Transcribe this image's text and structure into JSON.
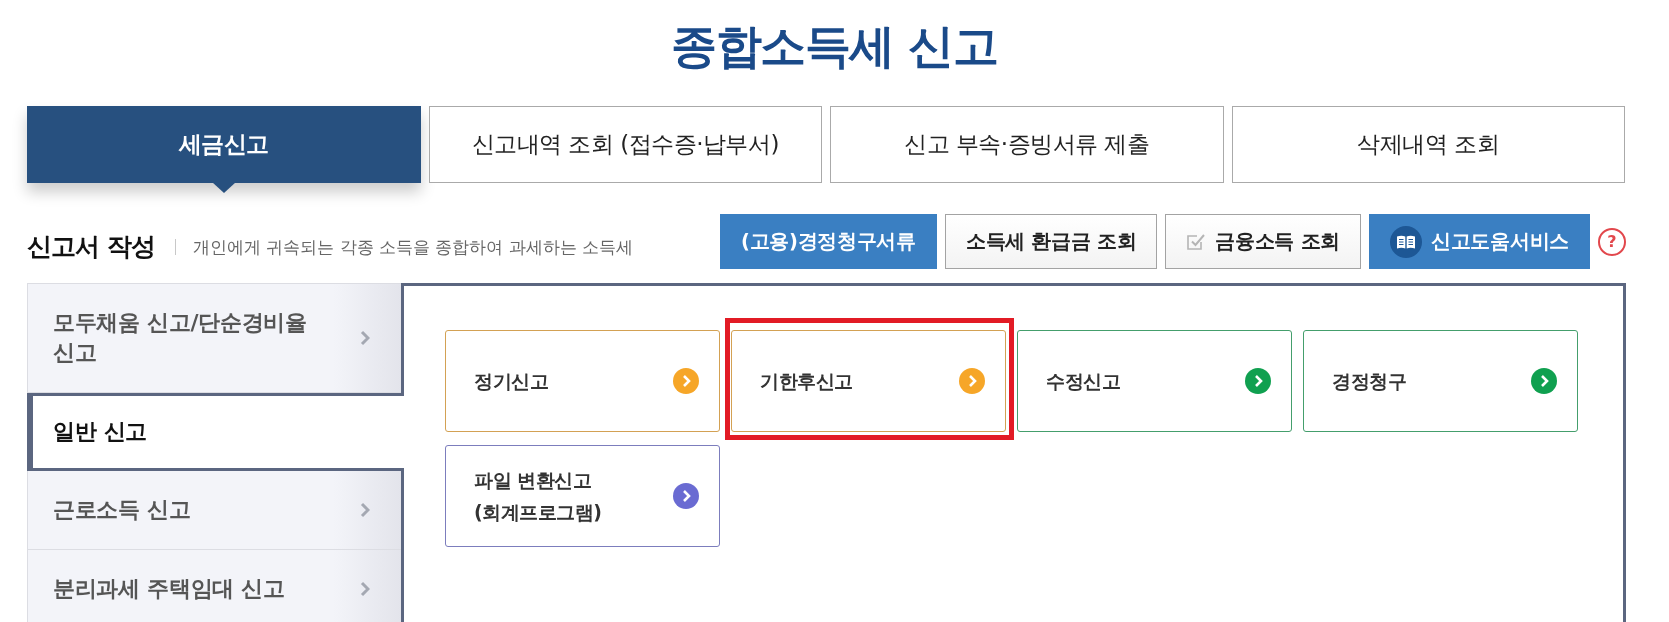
{
  "page_title": "종합소득세 신고",
  "tabs": [
    {
      "label": "세금신고",
      "selected": true
    },
    {
      "label": "신고내역 조회 (접수증·납부서)",
      "selected": false
    },
    {
      "label": "신고 부속·증빙서류 제출",
      "selected": false
    },
    {
      "label": "삭제내역 조회",
      "selected": false
    }
  ],
  "section": {
    "title": "신고서 작성",
    "description": "개인에게 귀속되는 각종 소득을 종합하여 과세하는 소득세"
  },
  "action_buttons": [
    {
      "label": "(고용)경정청구서류",
      "kind": "primary"
    },
    {
      "label": "소득세 환급금 조회",
      "kind": "plain"
    },
    {
      "label": "금융소득 조회",
      "kind": "checked"
    },
    {
      "label": "신고도움서비스",
      "kind": "guide"
    }
  ],
  "help_button": {
    "label": "?"
  },
  "sidebar": {
    "items": [
      {
        "label": "모두채움 신고/단순경비율 신고",
        "selected": false
      },
      {
        "label": "일반 신고",
        "selected": true
      },
      {
        "label": "근로소득 신고",
        "selected": false
      },
      {
        "label": "분리과세 주택임대 신고",
        "selected": false
      }
    ]
  },
  "cards": [
    {
      "label": "정기신고",
      "color": "#f6a628",
      "highlighted": false
    },
    {
      "label": "기한후신고",
      "color": "#f6a628",
      "highlighted": true
    },
    {
      "label": "수정신고",
      "color": "#10a050",
      "highlighted": false
    },
    {
      "label": "경정청구",
      "color": "#10a050",
      "highlighted": false
    },
    {
      "label": "파일 변환신고 (회계프로그램)",
      "color": "#6a6bd2",
      "highlighted": false
    }
  ]
}
